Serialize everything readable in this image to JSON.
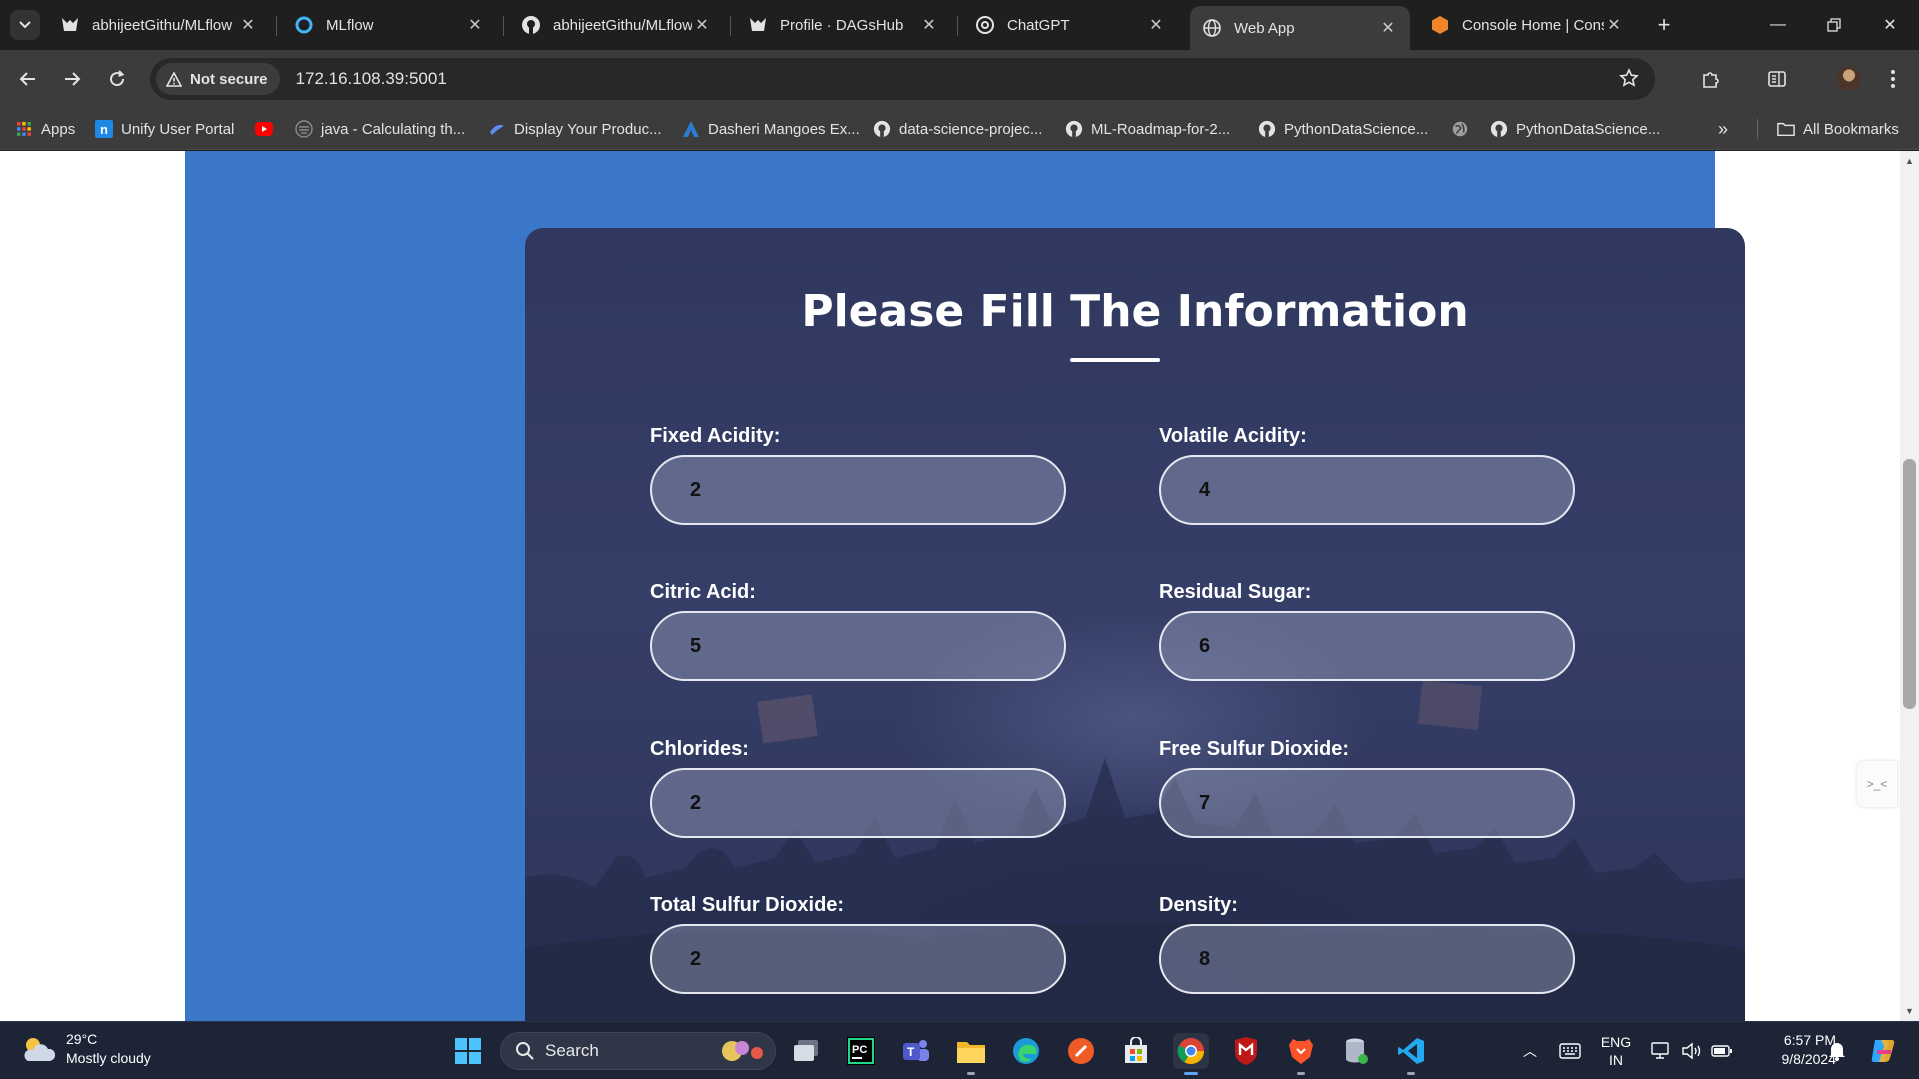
{
  "browser": {
    "tabs": [
      {
        "title": "abhijeetGithu/MLflow",
        "icon": "dagshub-icon"
      },
      {
        "title": "MLflow",
        "icon": "mlflow-icon"
      },
      {
        "title": "abhijeetGithu/MLflow",
        "icon": "github-icon"
      },
      {
        "title": "Profile · DAGsHub",
        "icon": "dagshub-icon"
      },
      {
        "title": "ChatGPT",
        "icon": "chatgpt-icon"
      },
      {
        "title": "Web App",
        "icon": "globe-icon",
        "active": true
      },
      {
        "title": "Console Home | Console",
        "icon": "aws-icon"
      }
    ],
    "security_label": "Not secure",
    "url": "172.16.108.39:5001",
    "bookmarks": [
      {
        "label": "Apps",
        "icon": "apps-grid-icon"
      },
      {
        "label": "Unify User Portal",
        "icon": "unify-icon"
      },
      {
        "label": "",
        "icon": "youtube-icon"
      },
      {
        "label": "java - Calculating th...",
        "icon": "stackexchange-icon"
      },
      {
        "label": "Display Your Produc...",
        "icon": "product-icon"
      },
      {
        "label": "Dasheri Mangoes Ex...",
        "icon": "mango-icon"
      },
      {
        "label": "data-science-projec...",
        "icon": "github-icon"
      },
      {
        "label": "ML-Roadmap-for-2...",
        "icon": "github-icon"
      },
      {
        "label": "PythonDataScience...",
        "icon": "github-icon"
      },
      {
        "label": "",
        "icon": "globe-icon"
      },
      {
        "label": "PythonDataScience...",
        "icon": "github-icon"
      }
    ],
    "all_bookmarks_label": "All Bookmarks"
  },
  "page": {
    "title": "Please Fill The Information",
    "fields": [
      {
        "label": "Fixed Acidity:",
        "value": "2"
      },
      {
        "label": "Volatile Acidity:",
        "value": "4"
      },
      {
        "label": "Citric Acid:",
        "value": "5"
      },
      {
        "label": "Residual Sugar:",
        "value": "6"
      },
      {
        "label": "Chlorides:",
        "value": "2"
      },
      {
        "label": "Free Sulfur Dioxide:",
        "value": "7"
      },
      {
        "label": "Total Sulfur Dioxide:",
        "value": "2"
      },
      {
        "label": "Density:",
        "value": "8"
      }
    ]
  },
  "taskbar": {
    "weather_temp": "29°C",
    "weather_desc": "Mostly cloudy",
    "search_label": "Search",
    "lang_top": "ENG",
    "lang_bottom": "IN",
    "time": "6:57 PM",
    "date": "9/8/2024"
  },
  "colors": {
    "page_blue": "#3a77c8",
    "card": "#323a62",
    "tab_bar": "#1f1f1f",
    "toolbar": "#3c3c3c"
  }
}
